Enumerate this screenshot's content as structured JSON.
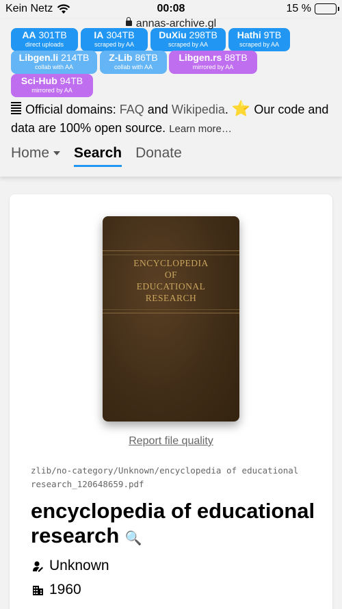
{
  "status": {
    "carrier": "Kein Netz",
    "time": "00:08",
    "battery": "15 %",
    "battery_level": 0.15
  },
  "browser": {
    "url": "annas-archive.gl"
  },
  "sources": [
    {
      "name": "AA",
      "size": "301TB",
      "sub": "direct uploads",
      "color": "#2196f3"
    },
    {
      "name": "IA",
      "size": "304TB",
      "sub": "scraped by AA",
      "color": "#2196f3"
    },
    {
      "name": "DuXiu",
      "size": "298TB",
      "sub": "scraped by AA",
      "color": "#2196f3"
    },
    {
      "name": "Hathi",
      "size": "9TB",
      "sub": "scraped by AA",
      "color": "#2196f3"
    },
    {
      "name": "Libgen.li",
      "size": "214TB",
      "sub": "collab with AA",
      "color": "#64b5f6"
    },
    {
      "name": "Z-Lib",
      "size": "86TB",
      "sub": "collab with AA",
      "color": "#64b5f6"
    },
    {
      "name": "Libgen.rs",
      "size": "88TB",
      "sub": "mirrored by AA",
      "color": "#c06ef0"
    },
    {
      "name": "Sci-Hub",
      "size": "94TB",
      "sub": "mirrored by AA",
      "color": "#c06ef0"
    }
  ],
  "domains": {
    "prefix": "Official domains:",
    "faq": "FAQ",
    "and": "and",
    "wikipedia": "Wikipedia",
    "period": ".",
    "open_source": "Our code and data are 100% open source.",
    "learn_more": "Learn more…"
  },
  "nav": {
    "home": "Home",
    "search": "Search",
    "donate": "Donate"
  },
  "book": {
    "cover_title": "ENCYCLOPEDIA OF EDUCATIONAL RESEARCH",
    "cover_lines": [
      "ENCYCLOPEDIA",
      "OF",
      "EDUCATIONAL",
      "RESEARCH"
    ],
    "report": "Report file quality",
    "path": "zlib/no-category/Unknown/encyclopedia of educational research_120648659.pdf",
    "title": "encyclopedia of educational research",
    "author": "Unknown",
    "year": "1960"
  }
}
